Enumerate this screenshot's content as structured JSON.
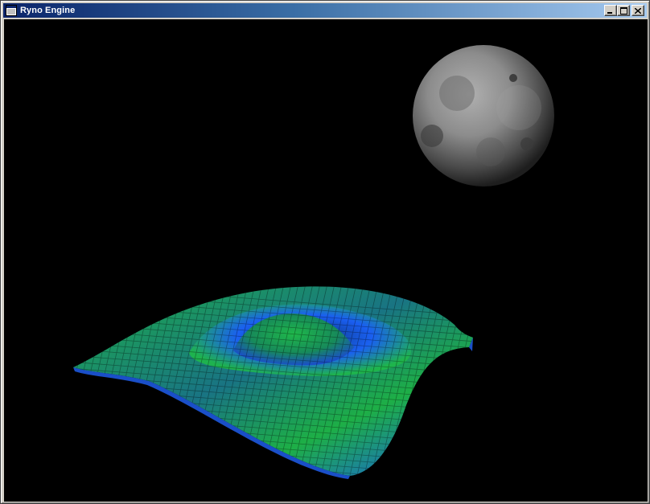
{
  "window": {
    "title": "Ryno Engine",
    "icon": "app-window-icon",
    "controls": [
      "minimize-icon",
      "maximize-icon",
      "close-icon"
    ]
  },
  "scene": {
    "background": "#000000",
    "objects": [
      {
        "name": "moon",
        "kind": "textured-sphere",
        "color": "#8a8a8a"
      },
      {
        "name": "wave-surface",
        "kind": "wireframe-mesh",
        "colors": [
          "#1fb84a",
          "#1a5cff"
        ]
      }
    ]
  },
  "colors": {
    "titlebar_start": "#0a246a",
    "titlebar_end": "#a6caf0",
    "mesh_green": "#1fb84a",
    "mesh_blue": "#1a5cff"
  }
}
